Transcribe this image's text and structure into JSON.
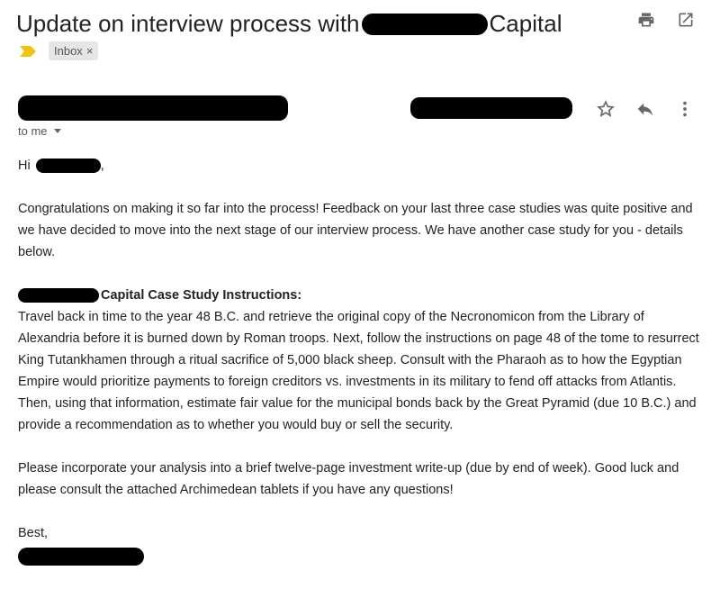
{
  "email": {
    "subject_prefix": "Update on interview process with",
    "subject_suffix": "Capital",
    "label": "Inbox",
    "label_remove": "×",
    "recipient": "to me",
    "greeting": "Hi",
    "greeting_punct": ",",
    "paragraph1": "Congratulations on making it so far into the process! Feedback on your last three case studies was quite positive and we have decided to move into the next stage of our interview process. We have another case study for you - details below.",
    "instructions_heading": "Capital Case Study Instructions:",
    "instructions_body": "Travel back in time to the year 48 B.C. and retrieve the original copy of the Necronomicon from the Library of Alexandria before it is burned down by Roman troops. Next, follow the instructions on page 48 of the tome to resurrect King Tutankhamen through a ritual sacrifice of 5,000 black sheep. Consult with the Pharaoh as to how the Egyptian Empire would prioritize payments to foreign creditors vs. investments in its military to fend off attacks from Atlantis. Then, using that information, estimate fair value for the municipal bonds back by the Great Pyramid (due 10 B.C.) and provide a recommendation as to whether you would buy or sell the security.",
    "paragraph3": "Please incorporate your analysis into a brief twelve-page investment write-up (due by end of week). Good luck and please consult the attached Archimedean tablets if you have any questions!",
    "signoff": "Best,"
  },
  "icons": {
    "print": "print-icon",
    "open_new_window": "open-in-new-window-icon",
    "important": "important-marker-icon",
    "star": "star-icon",
    "reply": "reply-icon",
    "more": "more-vert-icon",
    "dropdown": "chevron-down-icon"
  },
  "colors": {
    "important_marker": "#f4c20d",
    "icon_gray": "#666666",
    "chip_bg": "#e6e6e6"
  }
}
